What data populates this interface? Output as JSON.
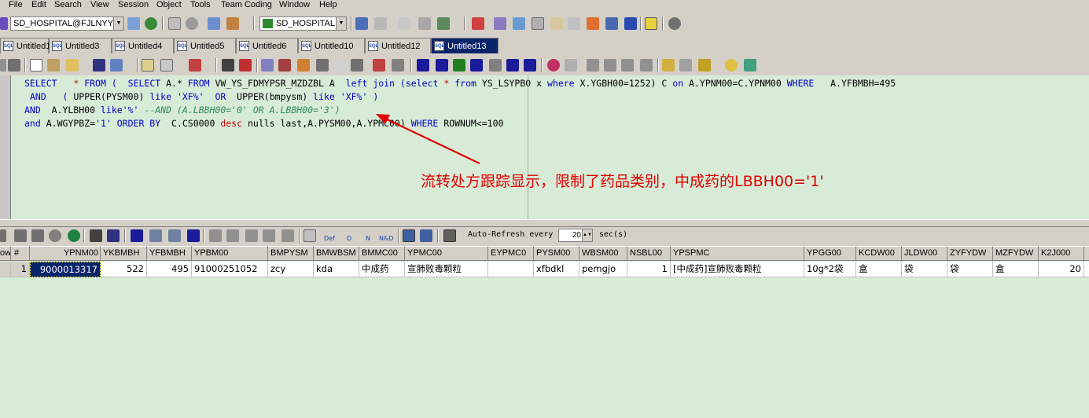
{
  "menu": [
    "File",
    "Edit",
    "Search",
    "View",
    "Session",
    "Object",
    "Tools",
    "Team Coding",
    "Window",
    "Help"
  ],
  "toolbar": {
    "connection_combo": "SD_HOSPITAL@FJLNYY(",
    "schema_combo": "SD_HOSPITAL"
  },
  "tabs": [
    "Untitled1",
    "Untitled3",
    "Untitled4",
    "Untitled5",
    "Untitled6",
    "Untitled10",
    "Untitled12",
    "Untitled13"
  ],
  "tab_icon_text": "SQL",
  "editor": {
    "line1": {
      "select": "SELECT",
      "star": "*",
      "from": "FROM",
      "open": "(",
      "select2": "SELECT",
      "astar": "A.*",
      "from2": "FROM",
      "view": "VW_YS_FDMYPSR_MZDZBL A",
      "leftjoin": "left join",
      "open2": "(",
      "select3": "select",
      "star3": "*",
      "from3": "from",
      "tbl": "YS_LSYPB0 x",
      "where": "where",
      "cond": "X.YGBH00=1252)",
      "c": "C",
      "on": "on",
      "join": "A.YPNM00=C.YPNM00",
      "where2": "WHERE",
      "cond2": "A.YFBMBH=495"
    },
    "line2": {
      "and": "AND",
      "open": "(",
      "upper1": "UPPER",
      "arg1": "(PYSM00)",
      "like1": "like",
      "str1": "'XF%'",
      "or": "OR",
      "upper2": "UPPER",
      "arg2": "(bmpysm)",
      "like2": "like",
      "str2": "'XF%'",
      "close": ")"
    },
    "line3": {
      "and": "AND",
      "col": "A.YLBH00",
      "like": "like",
      "str": "'%'",
      "comment": "--AND (A.LBBH00='0' OR A.LBBH00='3')"
    },
    "line4": {
      "and": "and",
      "cond": "A.WGYPBZ=",
      "str": "'1'",
      "order": "ORDER BY",
      "col": "C.CS0000",
      "desc": "desc",
      "nulls": "nulls last,A.PYSM00,A.YPMC00)",
      "where": "WHERE",
      "rownum": "ROWNUM<=100"
    }
  },
  "annotation": "流转处方跟踪显示，限制了药品类别，中成药的LBBH00='1'",
  "annotation_color": "#e00000",
  "grid_toolbar": {
    "auto_refresh_label": "Auto-Refresh every",
    "interval": "20",
    "unit": "sec(s)",
    "def_label": "Def",
    "d_label": "D",
    "n_label": "N",
    "nd_label": "N&D"
  },
  "grid": {
    "row_header": "ow",
    "row_num_header": "#",
    "columns": [
      "YPNM00",
      "YKBMBH",
      "YFBMBH",
      "YPBM00",
      "BMPYSM",
      "BMWBSM",
      "BMMC00",
      "YPMC00",
      "EYPMC0",
      "PYSM00",
      "WBSM00",
      "NSBL00",
      "YPSPMC",
      "YPGG00",
      "KCDW00",
      "JLDW00",
      "ZYFYDW",
      "MZFYDW",
      "K2J000"
    ],
    "rows": [
      {
        "num": "1",
        "cells": [
          "9000013317",
          "522",
          "495",
          "91000251052",
          "zcy",
          "kda",
          "中成药",
          "宣肺败毒颗粒",
          "",
          "xfbdkl",
          "pemgjo",
          "1",
          "[中成药]宣肺败毒颗粒",
          "10g*2袋",
          "盒",
          "袋",
          "袋",
          "盒",
          "20"
        ]
      }
    ]
  },
  "colors": {
    "editor_bg": "#d7ebd7",
    "keyword": "#0000c8",
    "comment": "#2e8b57",
    "selection": "#0a246a",
    "chrome": "#d4d0c8"
  }
}
